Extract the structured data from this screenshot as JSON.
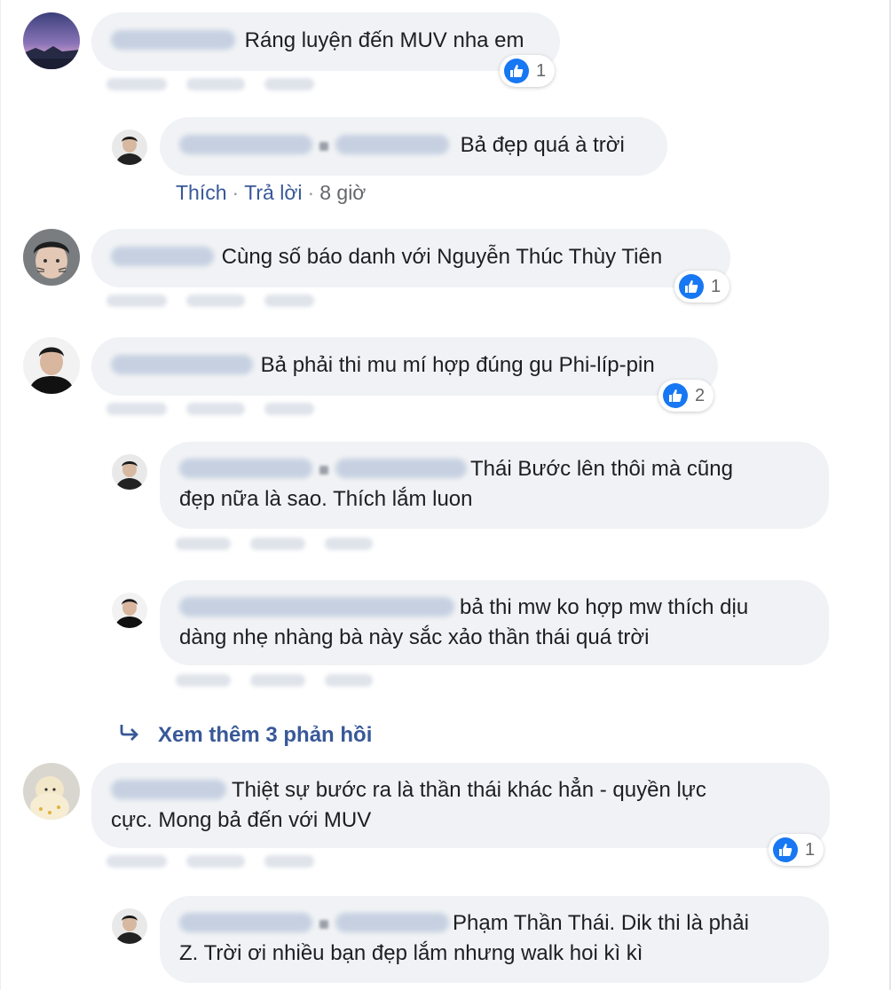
{
  "ui": {
    "like_color": "#1877f2",
    "bubble_color": "#f0f2f5",
    "link_color": "#385898"
  },
  "comments": [
    {
      "text": "Ráng luyện đến MUV nha em",
      "likes": "1",
      "avatar": "sunset-avatar"
    },
    {
      "text": "Bả đẹp quá à trời",
      "reply_like": "Thích",
      "reply_reply": "Trả lời",
      "reply_time": "8 giờ",
      "avatar": "user-avatar"
    },
    {
      "text": "Cùng số báo danh với Nguyễn Thúc Thùy Tiên",
      "likes": "1",
      "avatar": "cat-face-avatar"
    },
    {
      "text": "Bả phải thi mu mí hợp đúng gu Phi-líp-pin",
      "likes": "2",
      "avatar": "man-avatar"
    },
    {
      "line1": "Thái Bước lên thôi mà cũng",
      "line2": "đẹp nữa là sao. Thích lắm luon",
      "avatar": "user-avatar"
    },
    {
      "line1": "bả thi mw ko hợp mw thích dịu",
      "line2": "dàng nhẹ nhàng bà này sắc xảo thần thái quá trời",
      "avatar": "man-avatar"
    },
    {
      "line1": "Thiệt sự bước ra là thần thái khác hẳn - quyền lực",
      "line2": "cực. Mong bả đến với MUV",
      "likes": "1",
      "avatar": "baby-avatar"
    },
    {
      "line1": "Phạm Thần Thái. Dik thi là phải",
      "line2": "Z. Trời ơi nhiều bạn đẹp lắm nhưng walk hoi kì kì",
      "avatar": "user-avatar"
    }
  ],
  "view_more": "Xem thêm 3 phản hồi"
}
